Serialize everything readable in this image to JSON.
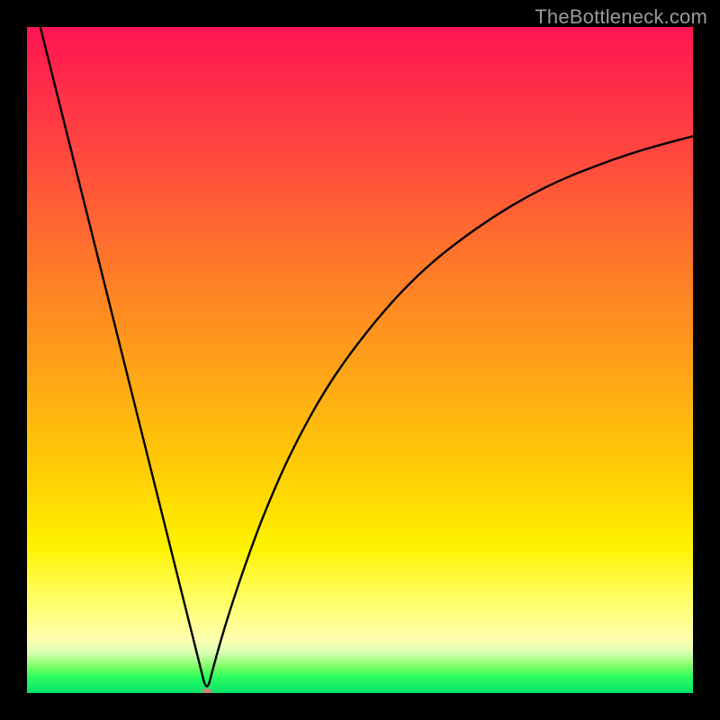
{
  "watermark": "TheBottleneck.com",
  "chart_data": {
    "type": "line",
    "title": "",
    "xlabel": "",
    "ylabel": "",
    "xlim": [
      0,
      100
    ],
    "ylim": [
      0,
      100
    ],
    "grid": false,
    "legend": false,
    "curve_description": "V-shaped bottleneck curve: steep linear descent from upper-left to a minimum near x≈27, then a concave rise toward the upper-right.",
    "min_point": {
      "x": 27,
      "y": 0
    },
    "series": [
      {
        "name": "bottleneck-curve",
        "x": [
          2,
          5,
          8,
          11,
          14,
          17,
          20,
          23,
          26,
          27,
          28,
          30,
          33,
          36,
          40,
          45,
          50,
          55,
          60,
          65,
          70,
          75,
          80,
          85,
          90,
          95,
          100
        ],
        "y": [
          100,
          88,
          76,
          64,
          52,
          40,
          28,
          16,
          4,
          0,
          4,
          11,
          20,
          28,
          37,
          46,
          53,
          59,
          64,
          68,
          71.5,
          74.5,
          77,
          79,
          80.8,
          82.3,
          83.6
        ]
      }
    ],
    "marker": {
      "x": 27,
      "y": 0,
      "color": "#d88080"
    },
    "background_gradient": {
      "top": "#ff1452",
      "mid_upper": "#ff8f20",
      "mid_lower": "#fff200",
      "bottom": "#06e36a"
    }
  }
}
